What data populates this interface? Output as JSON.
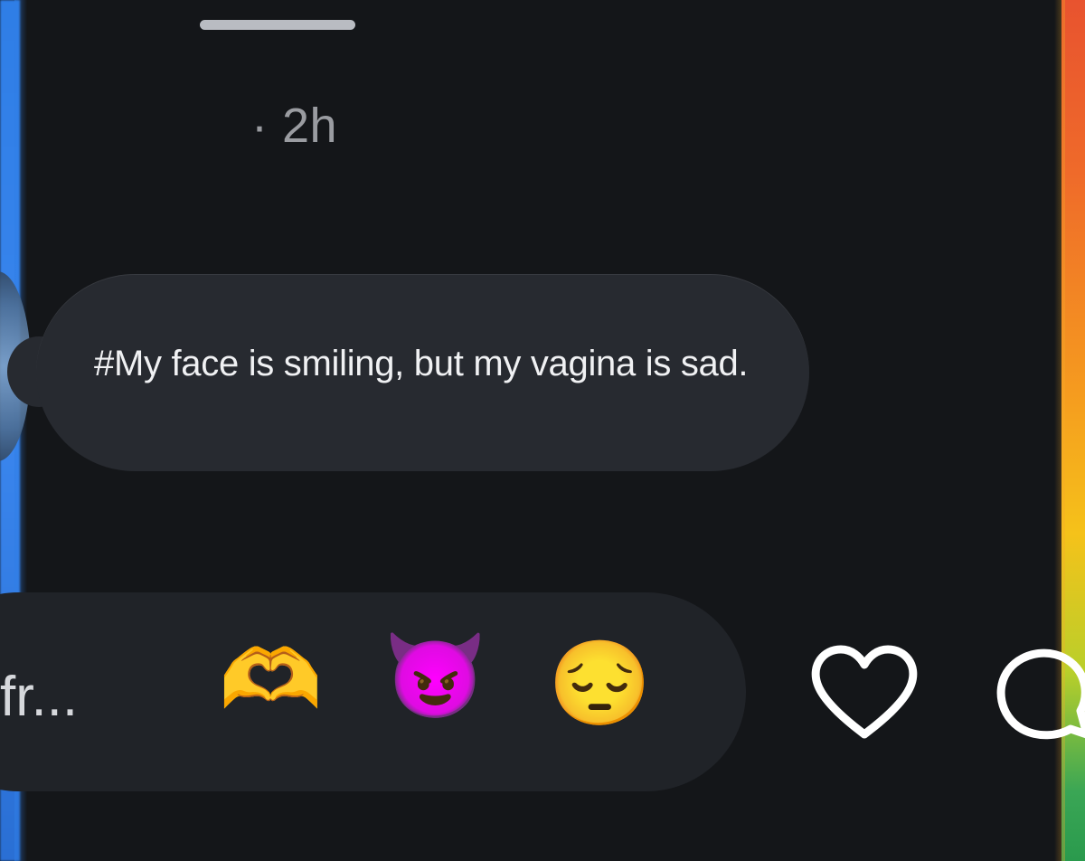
{
  "header": {
    "timestamp": "· 2h"
  },
  "message": {
    "text": "#My face is smiling, but my vagina is sad."
  },
  "reply_bar": {
    "placeholder": "fr...",
    "quick_reactions": [
      {
        "name": "heart-hands-emoji",
        "glyph": "🫶"
      },
      {
        "name": "smiling-devil-emoji",
        "glyph": "😈"
      },
      {
        "name": "pensive-face-emoji",
        "glyph": "😔"
      }
    ]
  },
  "actions": {
    "like_icon": "heart-outline-icon",
    "comment_icon": "comment-bubble-icon"
  },
  "colors": {
    "background": "#141619",
    "bubble": "#272a30",
    "reply_bar": "#202328",
    "timestamp_text": "#9a9ca1",
    "message_text": "#f0f1f3"
  }
}
